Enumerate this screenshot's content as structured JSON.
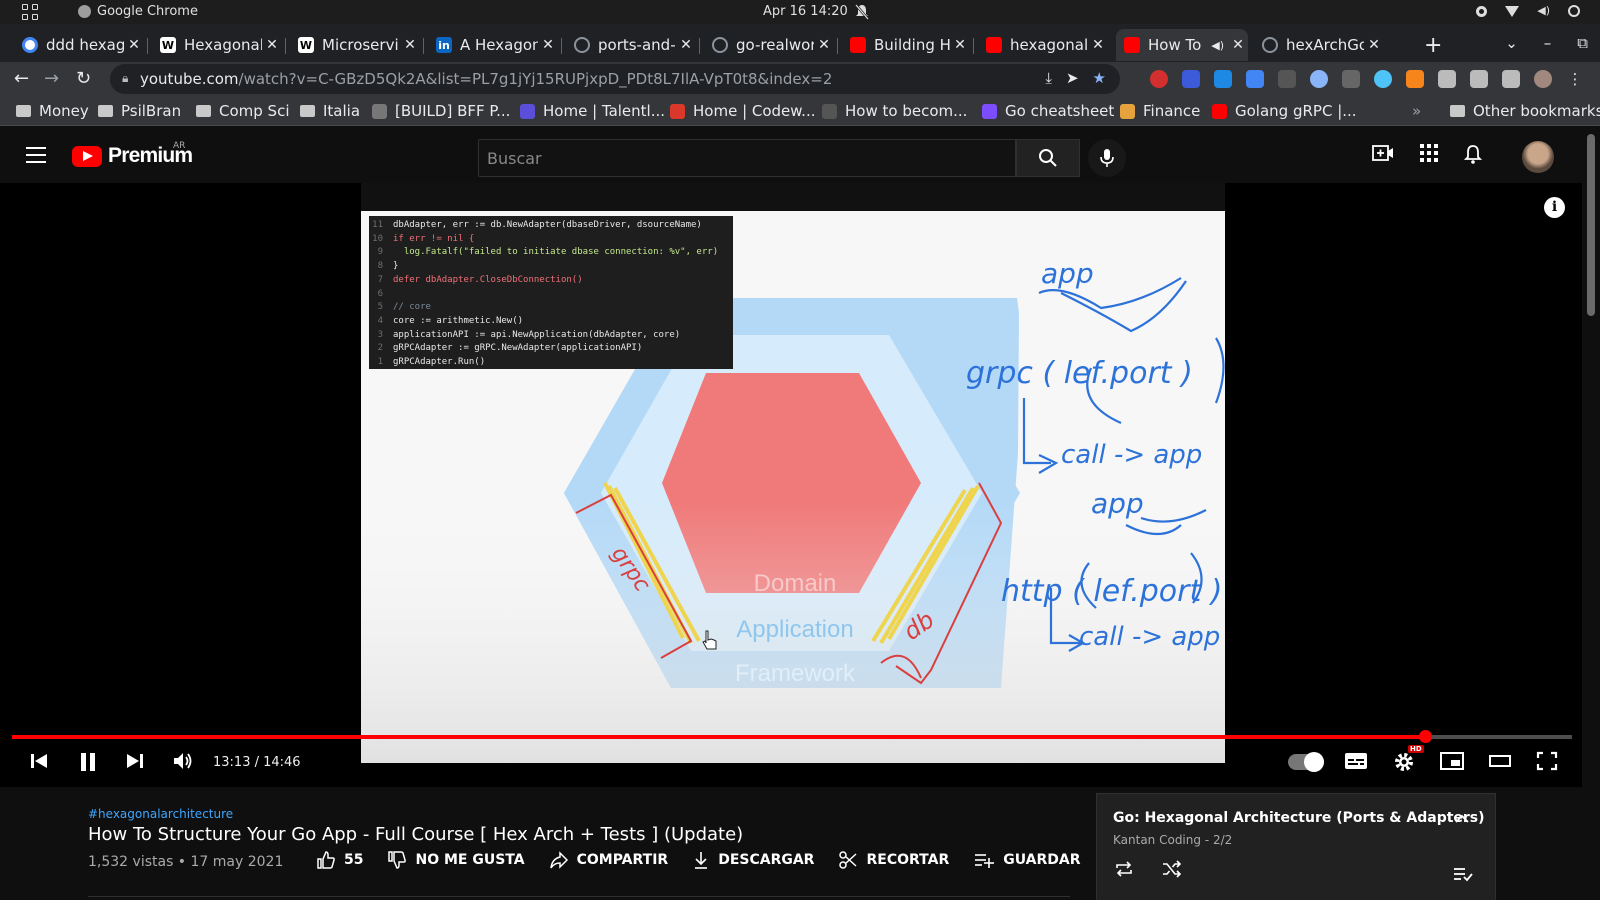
{
  "os": {
    "app_name": "Google Chrome",
    "clock": "Apr 16  14:20"
  },
  "tabs": [
    {
      "label": "ddd hexago",
      "icon": "google-icon",
      "color": "#ffffff"
    },
    {
      "label": "Hexagonal",
      "icon": "wikipedia-icon",
      "color": "#ffffff"
    },
    {
      "label": "Microservi",
      "icon": "wikipedia-icon",
      "color": "#ffffff"
    },
    {
      "label": "A Hexagon",
      "icon": "linkedin-icon",
      "color": "#0a66c2"
    },
    {
      "label": "ports-and-",
      "icon": "github-icon",
      "color": "#8b949e"
    },
    {
      "label": "go-realwor",
      "icon": "github-icon",
      "color": "#8b949e"
    },
    {
      "label": "Building H",
      "icon": "youtube-icon",
      "color": "#ff0000"
    },
    {
      "label": "hexagonal",
      "icon": "youtube-icon",
      "color": "#ff0000"
    },
    {
      "label": "How To",
      "icon": "youtube-icon",
      "color": "#ff0000"
    },
    {
      "label": "hexArchGo",
      "icon": "github-icon",
      "color": "#8b949e"
    }
  ],
  "address": {
    "host": "youtube.com",
    "path": "/watch?v=C-GBzD5Qk2A&list=PL7g1jYj15RUPjxpD_PDt8L7IlA-VpT0t8&index=2"
  },
  "bookmarks": [
    {
      "label": "Money",
      "type": "folder"
    },
    {
      "label": "PsilBran",
      "type": "folder"
    },
    {
      "label": "Comp Sci",
      "type": "folder"
    },
    {
      "label": "Italia",
      "type": "folder"
    },
    {
      "label": "[BUILD] BFF P...",
      "type": "site"
    },
    {
      "label": "Home | Talentl...",
      "type": "site"
    },
    {
      "label": "Home | Codew...",
      "type": "site"
    },
    {
      "label": "How to becom...",
      "type": "site"
    },
    {
      "label": "Go cheatsheet",
      "type": "site"
    },
    {
      "label": "Finance",
      "type": "site"
    },
    {
      "label": "Golang gRPC |...",
      "type": "site"
    },
    {
      "label": "Other bookmarks",
      "type": "folder"
    }
  ],
  "yt": {
    "brand": "Premium",
    "region": "AR",
    "search_placeholder": "Buscar"
  },
  "video": {
    "code_lines": [
      {
        "n": "11",
        "code": "dbAdapter, err := db.NewAdapter(dbaseDriver, dsourceName)"
      },
      {
        "n": "10",
        "code": "if err != nil {"
      },
      {
        "n": "9",
        "code": "  log.Fatalf(\"failed to initiate dbase connection: %v\", err)"
      },
      {
        "n": "8",
        "code": "}"
      },
      {
        "n": "7",
        "code": "defer dbAdapter.CloseDbConnection()"
      },
      {
        "n": "6",
        "code": ""
      },
      {
        "n": "5",
        "code": "// core"
      },
      {
        "n": "4",
        "code": "core := arithmetic.New()"
      },
      {
        "n": "3",
        "code": "applicationAPI := api.NewApplication(dbAdapter, core)"
      },
      {
        "n": "2",
        "code": "gRPCAdapter := gRPC.NewAdapter(applicationAPI)"
      },
      {
        "n": "1",
        "code": "gRPCAdapter.Run()"
      }
    ],
    "diagram": {
      "domain_label": "Domain",
      "application_label": "Application",
      "framework_label": "Framework"
    },
    "handwriting": [
      "app",
      "grpc ( lef.port )",
      "call -> app",
      "app",
      "http ( lef.port )",
      "call -> app",
      "grpc",
      "db"
    ],
    "time_current": "13:13",
    "time_total": "14:46",
    "time_display": "13:13 / 14:46",
    "progress": 0.906,
    "hd_badge": "HD"
  },
  "info": {
    "hashtag": "#hexagonalarchitecture",
    "title": "How To Structure Your Go App - Full Course [ Hex Arch + Tests ] (Update)",
    "views": "1,532 vistas • 17 may 2021",
    "likes": "55",
    "dislike_label": "NO ME GUSTA",
    "share_label": "COMPARTIR",
    "download_label": "DESCARGAR",
    "clip_label": "RECORTAR",
    "save_label": "GUARDAR"
  },
  "playlist": {
    "title": "Go: Hexagonal Architecture (Ports & Adapters)",
    "channel": "Kantan Coding",
    "position": "2/2"
  },
  "colors": {
    "yt_red": "#ff0000",
    "hex_domain": "#f07a7a",
    "hex_app": "#d6ebfb",
    "hex_framework": "#b4d9f7",
    "ink_blue": "#2d72d9",
    "ink_red": "#d93f3f",
    "highlight_yellow": "#f2d23c"
  }
}
